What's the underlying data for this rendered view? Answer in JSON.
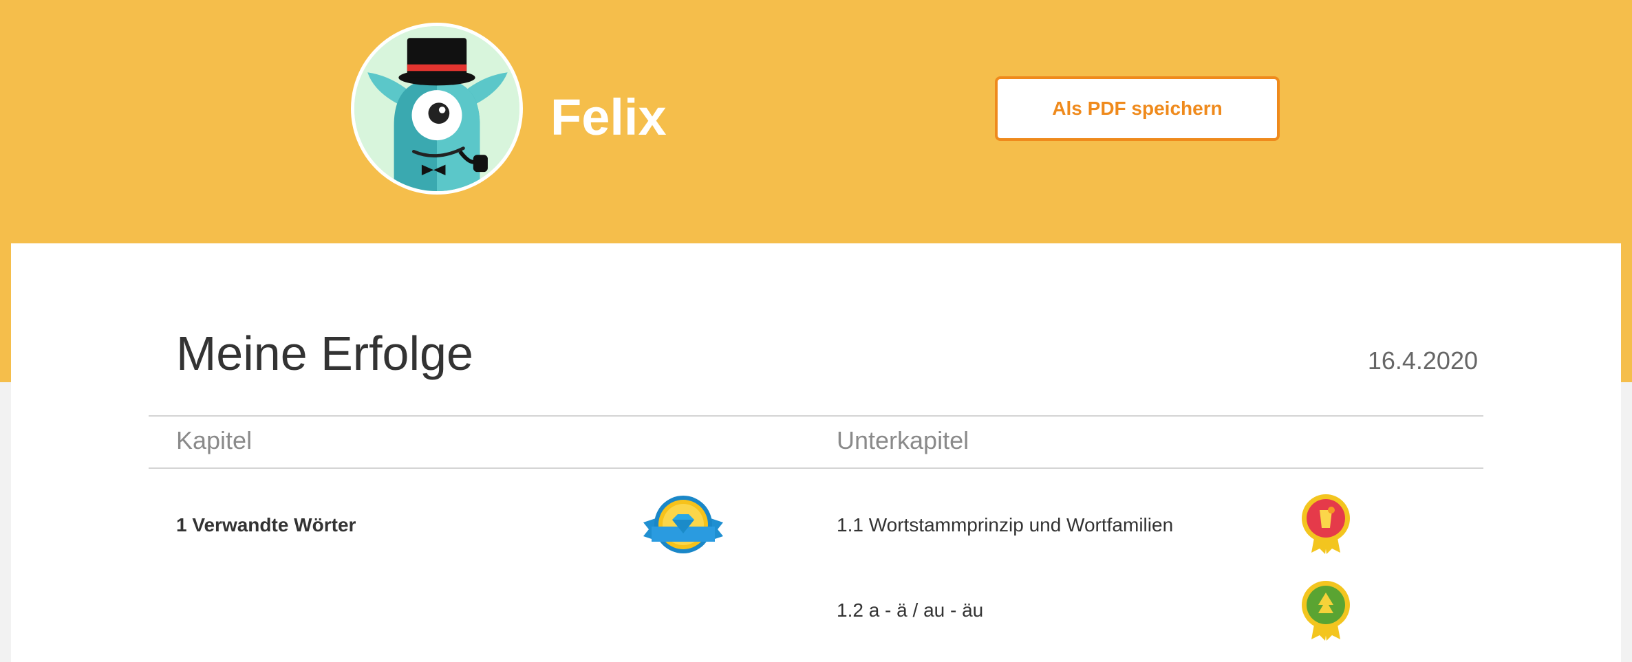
{
  "header": {
    "avatar_icon": "monster-top-hat-avatar-icon",
    "username": "Felix",
    "pdf_button_label": "Als PDF speichern"
  },
  "main": {
    "title": "Meine Erfolge",
    "date": "16.4.2020",
    "columns": {
      "chapter": "Kapitel",
      "subchapter": "Unterkapitel"
    },
    "chapters": [
      {
        "label": "1 Verwandte Wörter",
        "badge_icon": "diamond-badge-icon",
        "subchapters": [
          {
            "label": "1.1 Wortstammprinzip und Wortfamilien",
            "badge_icon": "drink-medal-icon"
          },
          {
            "label": "1.2 a - ä / au - äu",
            "badge_icon": "tree-medal-icon"
          }
        ]
      }
    ]
  },
  "colors": {
    "banner": "#f5be4b",
    "accent_orange": "#ef8a1c",
    "text_dark": "#333333"
  }
}
